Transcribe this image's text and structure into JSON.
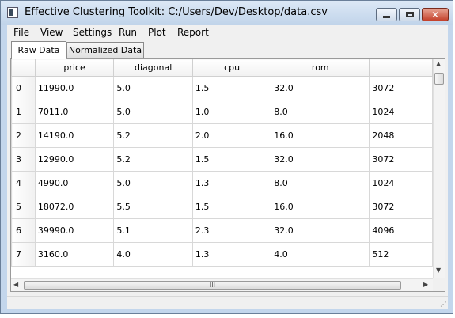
{
  "window": {
    "title": "Effective Clustering Toolkit: C:/Users/Dev/Desktop/data.csv",
    "minimize_icon": "minimize-icon",
    "maximize_icon": "maximize-icon",
    "close_icon": "close-icon",
    "close_glyph": "✕"
  },
  "menu": [
    "File",
    "View",
    "Settings",
    "Run",
    "Plot",
    "Report"
  ],
  "tabs": [
    {
      "label": "Raw Data",
      "active": true
    },
    {
      "label": "Normalized Data",
      "active": false
    }
  ],
  "table": {
    "columns": [
      "price",
      "diagonal",
      "cpu",
      "rom",
      ""
    ],
    "rows": [
      {
        "index": "0",
        "cells": [
          "11990.0",
          "5.0",
          "1.5",
          "32.0",
          "3072"
        ]
      },
      {
        "index": "1",
        "cells": [
          "7011.0",
          "5.0",
          "1.0",
          "8.0",
          "1024"
        ]
      },
      {
        "index": "2",
        "cells": [
          "14190.0",
          "5.2",
          "2.0",
          "16.0",
          "2048"
        ]
      },
      {
        "index": "3",
        "cells": [
          "12990.0",
          "5.2",
          "1.5",
          "32.0",
          "3072"
        ]
      },
      {
        "index": "4",
        "cells": [
          "4990.0",
          "5.0",
          "1.3",
          "8.0",
          "1024"
        ]
      },
      {
        "index": "5",
        "cells": [
          "18072.0",
          "5.5",
          "1.5",
          "16.0",
          "3072"
        ]
      },
      {
        "index": "6",
        "cells": [
          "39990.0",
          "5.1",
          "2.3",
          "32.0",
          "4096"
        ]
      },
      {
        "index": "7",
        "cells": [
          "3160.0",
          "4.0",
          "1.3",
          "4.0",
          "512"
        ]
      }
    ]
  },
  "scrollbars": {
    "up_arrow": "▲",
    "down_arrow": "▼",
    "left_arrow": "◀",
    "right_arrow": "▶",
    "grip": "III"
  },
  "statusbar": {
    "resize_grip": "⋰"
  },
  "colors": {
    "titlebar": "#c3d6ec",
    "close_button": "#c4402a",
    "client_bg": "#f0f0f0",
    "grid_border": "#d8d8d8"
  }
}
